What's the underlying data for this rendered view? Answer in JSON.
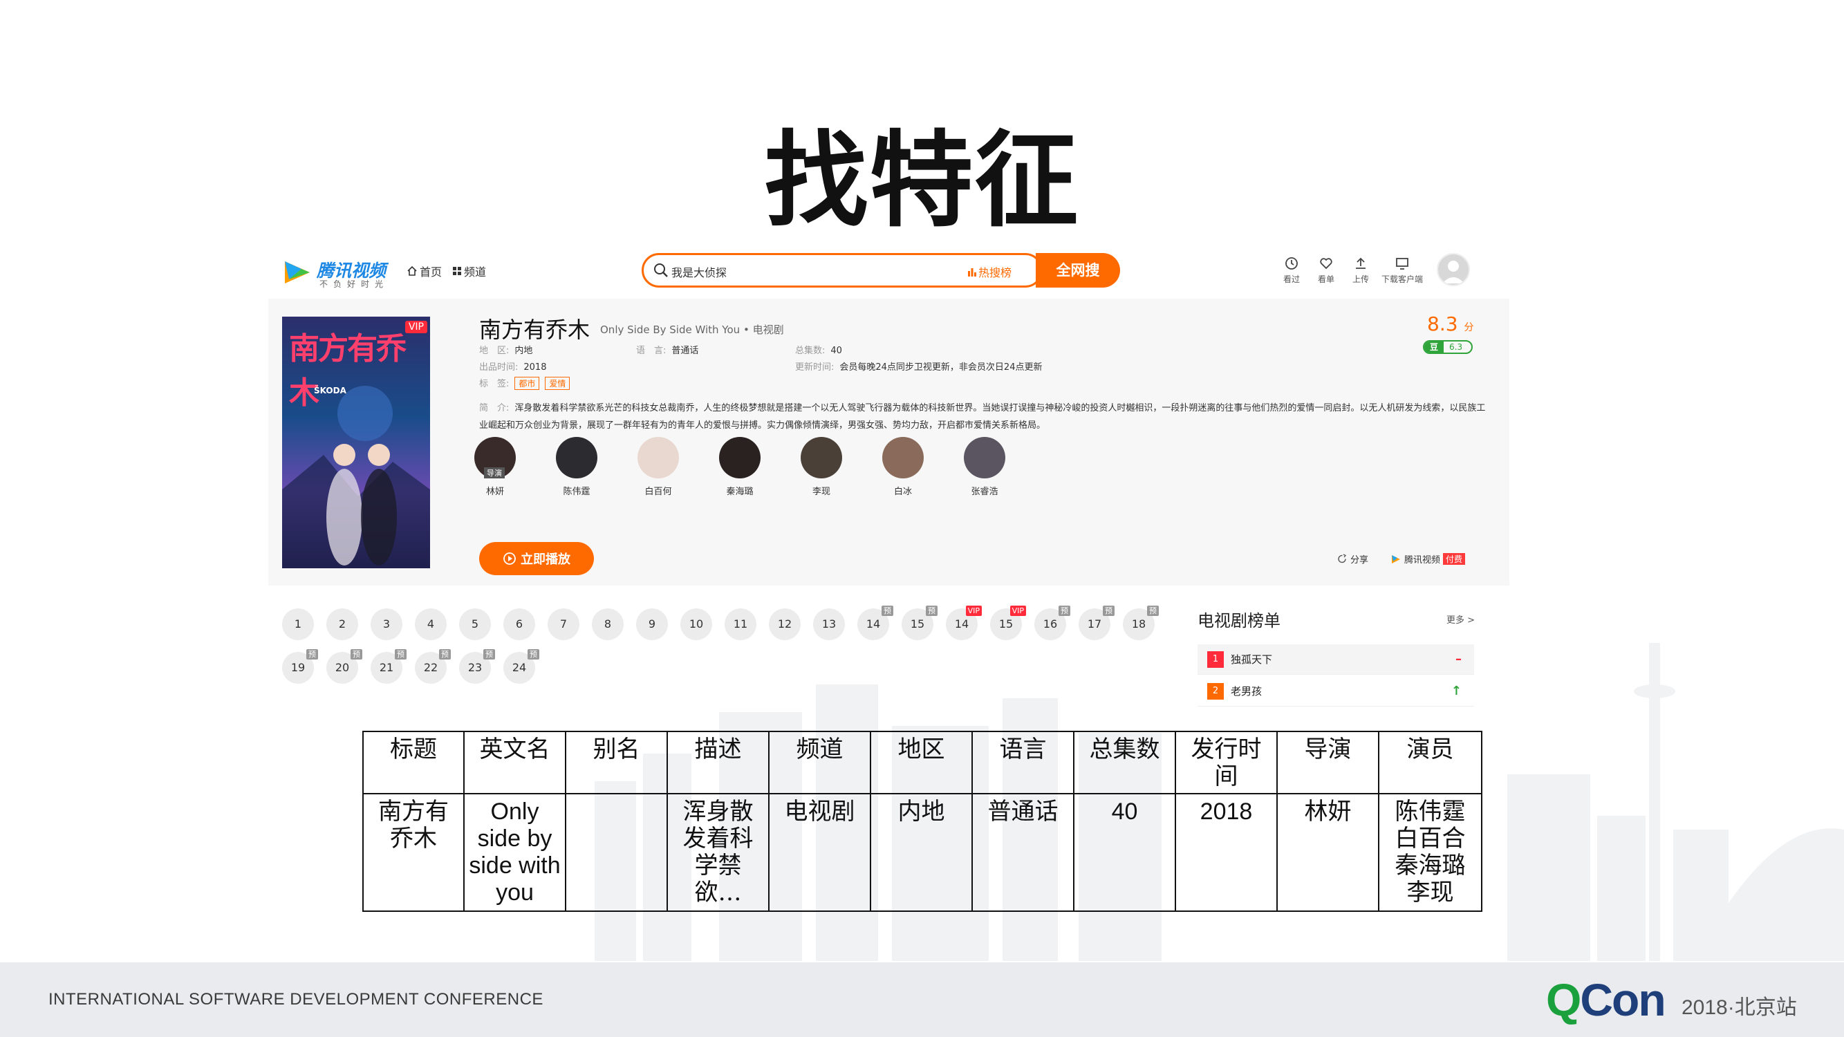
{
  "slide": {
    "title": "找特征"
  },
  "app": {
    "logo_name": "腾讯视频",
    "logo_slogan": "不负好时光",
    "nav": {
      "home": "首页",
      "channel": "频道"
    },
    "search": {
      "query": "我是大侦探",
      "hot": "热搜榜",
      "button": "全网搜"
    },
    "tools": [
      "看过",
      "看单",
      "上传",
      "下载客户端"
    ]
  },
  "show": {
    "poster_title": "南方有乔木",
    "poster_vip": "VIP",
    "poster_brand": "ŠKODA",
    "title": "南方有乔木",
    "english_title": "Only Side By Side With You",
    "type": "电视剧",
    "score": "8.3",
    "score_unit": "分",
    "douban_label": "豆",
    "douban_score": "6.3",
    "region_label": "地　区:",
    "region": "内地",
    "language_label": "语　言:",
    "language": "普通话",
    "episodes_label": "总集数:",
    "episodes": "40",
    "release_label": "出品时间:",
    "release": "2018",
    "update_label": "更新时间:",
    "update": "会员每晚24点同步卫视更新，非会员次日24点更新",
    "tags_label": "标　签:",
    "tags": [
      "都市",
      "爱情"
    ],
    "desc_label": "简　介:",
    "description": "浑身散发着科学禁欲系光芒的科技女总裁南乔，人生的终极梦想就是搭建一个以无人驾驶飞行器为载体的科技新世界。当她误打误撞与神秘冷峻的投资人时樾相识，一段扑朔迷离的往事与他们热烈的爱情一同启封。以无人机研发为线索，以民族工业崛起和万众创业为背景，展现了一群年轻有为的青年人的爱恨与拼搏。实力偶像倾情演绎，男强女强、势均力敌，开启都市爱情关系新格局。",
    "cast": [
      {
        "name": "林妍",
        "role": "导演",
        "color": "#3a2b2b"
      },
      {
        "name": "陈伟霆",
        "role": "",
        "color": "#2c2c30"
      },
      {
        "name": "白百何",
        "role": "",
        "color": "#e9d8cf"
      },
      {
        "name": "秦海璐",
        "role": "",
        "color": "#2a2220"
      },
      {
        "name": "李现",
        "role": "",
        "color": "#4a4038"
      },
      {
        "name": "白冰",
        "role": "",
        "color": "#8a6a5a"
      },
      {
        "name": "张睿浩",
        "role": "",
        "color": "#5a5560"
      }
    ],
    "play_button": "立即播放",
    "share": "分享",
    "source": "腾讯视频",
    "source_badge": "付费"
  },
  "episodes": {
    "row1": [
      {
        "n": "1",
        "badge": ""
      },
      {
        "n": "2",
        "badge": ""
      },
      {
        "n": "3",
        "badge": ""
      },
      {
        "n": "4",
        "badge": ""
      },
      {
        "n": "5",
        "badge": ""
      },
      {
        "n": "6",
        "badge": ""
      },
      {
        "n": "7",
        "badge": ""
      },
      {
        "n": "8",
        "badge": ""
      },
      {
        "n": "9",
        "badge": ""
      },
      {
        "n": "10",
        "badge": ""
      },
      {
        "n": "11",
        "badge": ""
      },
      {
        "n": "12",
        "badge": ""
      },
      {
        "n": "13",
        "badge": ""
      },
      {
        "n": "14",
        "badge": "预"
      },
      {
        "n": "15",
        "badge": "预"
      },
      {
        "n": "14",
        "badge": "VIP"
      },
      {
        "n": "15",
        "badge": "VIP"
      },
      {
        "n": "16",
        "badge": "预"
      },
      {
        "n": "17",
        "badge": "预"
      },
      {
        "n": "18",
        "badge": "预"
      }
    ],
    "row2": [
      {
        "n": "19",
        "badge": "预"
      },
      {
        "n": "20",
        "badge": "预"
      },
      {
        "n": "21",
        "badge": "预"
      },
      {
        "n": "22",
        "badge": "预"
      },
      {
        "n": "23",
        "badge": "预"
      },
      {
        "n": "24",
        "badge": "预"
      }
    ]
  },
  "ranking": {
    "title": "电视剧榜单",
    "more": "更多 >",
    "items": [
      {
        "rank": "1",
        "name": "独孤天下",
        "trend": "–",
        "color": "#ff2b3a",
        "trend_color": "#ff2b3a"
      },
      {
        "rank": "2",
        "name": "老男孩",
        "trend": "↑",
        "color": "#ff6a00",
        "trend_color": "#2fa43a"
      }
    ]
  },
  "table": {
    "headers": [
      "标题",
      "英文名",
      "别名",
      "描述",
      "频道",
      "地区",
      "语言",
      "总集数",
      "发行时间",
      "导演",
      "演员"
    ],
    "row": [
      "南方有乔木",
      "Only side by side with you",
      "",
      "浑身散发着科学禁欲…",
      "电视剧",
      "内地",
      "普通话",
      "40",
      "2018",
      "林妍",
      "陈伟霆 白百合 秦海璐 李现"
    ]
  },
  "footer": {
    "conference": "INTERNATIONAL SOFTWARE DEVELOPMENT CONFERENCE",
    "brand_q": "Q",
    "brand_con": "Con",
    "year_city": "2018·北京站"
  },
  "colors": {
    "accent": "#ff6a00",
    "qcon_green": "#1aa03c",
    "qcon_navy": "#1e3f7a",
    "douban": "#2fa43a"
  }
}
